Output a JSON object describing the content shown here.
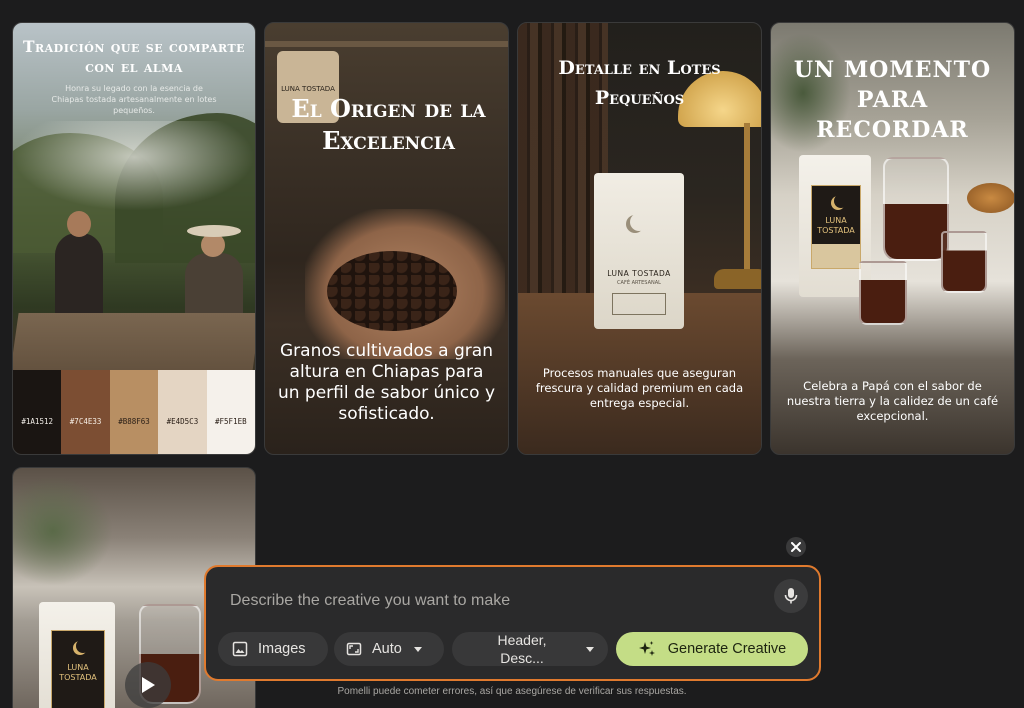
{
  "cards": [
    {
      "title": "Tradición que se comparte con el alma",
      "subtitle": "Honra su legado con la esencia de Chiapas tostada artesanalmente en lotes pequeños.",
      "palette": [
        {
          "hex": "#1A1512",
          "color": "#1A1512",
          "text_color": "#f0ece6"
        },
        {
          "hex": "#7C4E33",
          "color": "#7C4E33",
          "text_color": "#f7efe6"
        },
        {
          "hex": "#B88F63",
          "color": "#B88F63",
          "text_color": "#2a1f17"
        },
        {
          "hex": "#E4D5C3",
          "color": "#E4D5C3",
          "text_color": "#2a1f17"
        },
        {
          "hex": "#F5F1EB",
          "color": "#F5F1EB",
          "text_color": "#2a1f17"
        }
      ]
    },
    {
      "title": "El Origen de la Excelencia",
      "subtitle": "Granos cultivados a gran altura en Chiapas para un perfil de sabor único y sofisticado.",
      "bag_text": "LUNA TOSTADA"
    },
    {
      "title": "Detalle en Lotes Pequeños",
      "subtitle": "Procesos manuales que aseguran frescura y calidad premium en cada entrega especial.",
      "bag_label": "LUNA TOSTADA",
      "bag_sublabel": "CAFÉ ARTESANAL"
    },
    {
      "title": "UN MOMENTO PARA RECORDAR",
      "subtitle": "Celebra a Papá con el sabor de nuestra tierra y la calidez de un café excepcional.",
      "bag_label_line1": "LUNA",
      "bag_label_line2": "TOSTADA"
    },
    {
      "bag_label_line1": "LUNA",
      "bag_label_line2": "TOSTADA",
      "play_icon": "play-icon"
    }
  ],
  "prompt": {
    "placeholder": "Describe the creative you want to make",
    "mic_icon": "microphone-icon",
    "chips": {
      "images": {
        "label": "Images",
        "icon": "image-icon"
      },
      "auto": {
        "label": "Auto",
        "icon": "aspect-ratio-icon"
      },
      "header": {
        "label": "Header, Desc...",
        "icon": "chevron-down-icon"
      }
    },
    "generate": {
      "label": "Generate Creative",
      "icon": "sparkle-icon"
    },
    "accent_color": "#E07A2E",
    "generate_color": "#C4DD86"
  },
  "close_icon": "close-icon",
  "disclaimer": "Pomelli puede cometer errores, así que asegúrese de verificar sus respuestas."
}
